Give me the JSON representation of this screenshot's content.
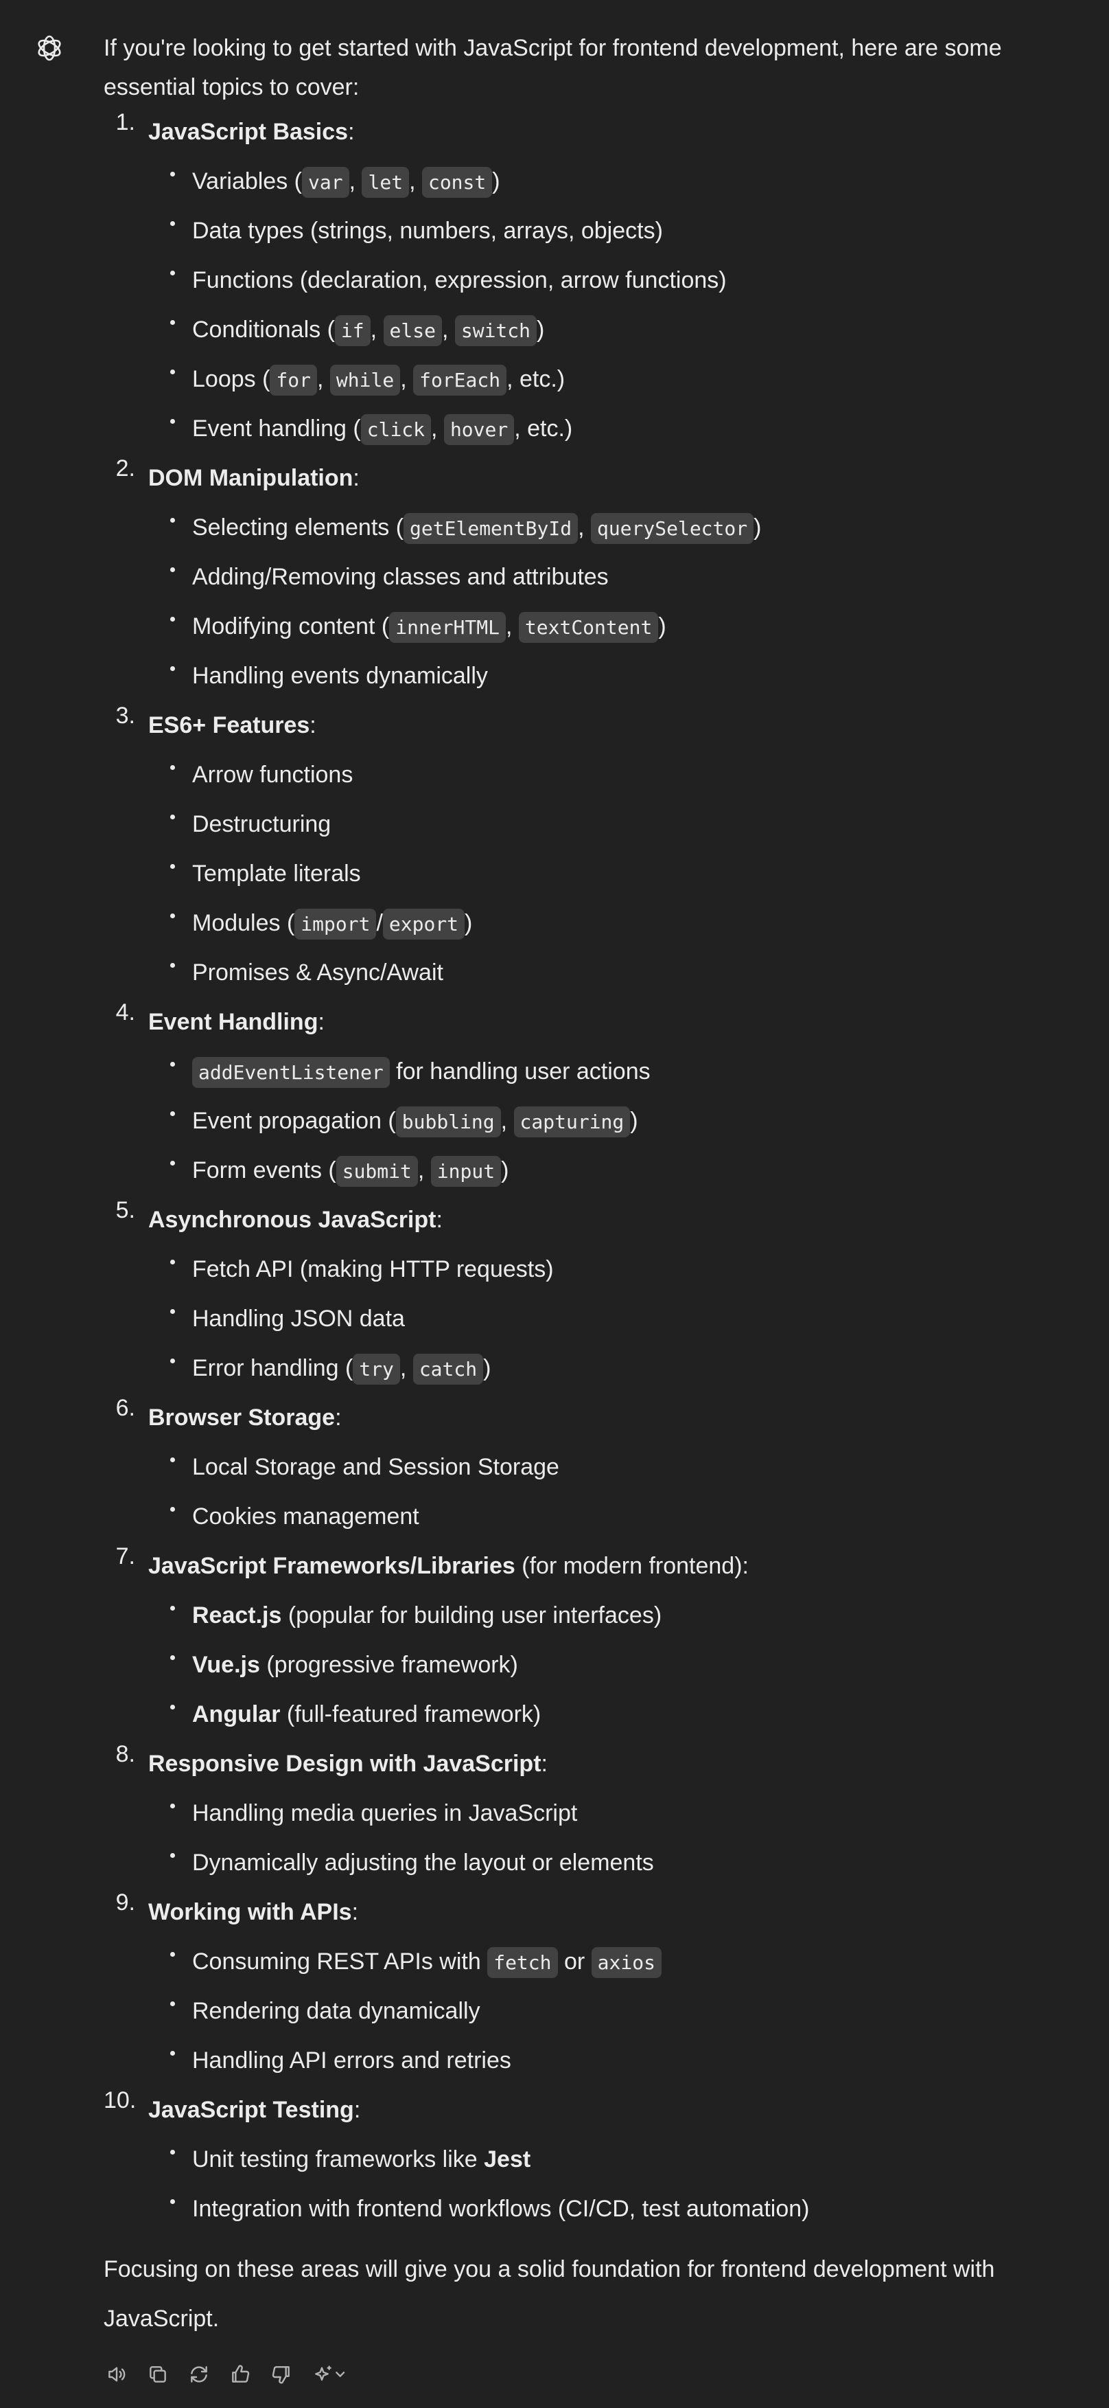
{
  "message": {
    "intro": "If you're looking to get started with JavaScript for frontend development, here are some essential topics to cover:",
    "topics": [
      {
        "num": "1.",
        "title": "JavaScript Basics",
        "title_suffix": "",
        "items": [
          [
            {
              "t": "Variables ("
            },
            {
              "c": "var"
            },
            {
              "t": ", "
            },
            {
              "c": "let"
            },
            {
              "t": ", "
            },
            {
              "c": "const"
            },
            {
              "t": ")"
            }
          ],
          [
            {
              "t": "Data types (strings, numbers, arrays, objects)"
            }
          ],
          [
            {
              "t": "Functions (declaration, expression, arrow functions)"
            }
          ],
          [
            {
              "t": "Conditionals ("
            },
            {
              "c": "if"
            },
            {
              "t": ", "
            },
            {
              "c": "else"
            },
            {
              "t": ", "
            },
            {
              "c": "switch"
            },
            {
              "t": ")"
            }
          ],
          [
            {
              "t": "Loops ("
            },
            {
              "c": "for"
            },
            {
              "t": ", "
            },
            {
              "c": "while"
            },
            {
              "t": ", "
            },
            {
              "c": "forEach"
            },
            {
              "t": ", etc.)"
            }
          ],
          [
            {
              "t": "Event handling ("
            },
            {
              "c": "click"
            },
            {
              "t": ", "
            },
            {
              "c": "hover"
            },
            {
              "t": ", etc.)"
            }
          ]
        ]
      },
      {
        "num": "2.",
        "title": "DOM Manipulation",
        "title_suffix": "",
        "items": [
          [
            {
              "t": "Selecting elements ("
            },
            {
              "c": "getElementById"
            },
            {
              "t": ", "
            },
            {
              "c": "querySelector"
            },
            {
              "t": ")"
            }
          ],
          [
            {
              "t": "Adding/Removing classes and attributes"
            }
          ],
          [
            {
              "t": "Modifying content ("
            },
            {
              "c": "innerHTML"
            },
            {
              "t": ", "
            },
            {
              "c": "textContent"
            },
            {
              "t": ")"
            }
          ],
          [
            {
              "t": "Handling events dynamically"
            }
          ]
        ]
      },
      {
        "num": "3.",
        "title": "ES6+ Features",
        "title_suffix": "",
        "items": [
          [
            {
              "t": "Arrow functions"
            }
          ],
          [
            {
              "t": "Destructuring"
            }
          ],
          [
            {
              "t": "Template literals"
            }
          ],
          [
            {
              "t": "Modules ("
            },
            {
              "c": "import"
            },
            {
              "t": "/"
            },
            {
              "c": "export"
            },
            {
              "t": ")"
            }
          ],
          [
            {
              "t": "Promises & Async/Await"
            }
          ]
        ]
      },
      {
        "num": "4.",
        "title": "Event Handling",
        "title_suffix": "",
        "items": [
          [
            {
              "c": "addEventListener"
            },
            {
              "t": " for handling user actions"
            }
          ],
          [
            {
              "t": "Event propagation ("
            },
            {
              "c": "bubbling"
            },
            {
              "t": ", "
            },
            {
              "c": "capturing"
            },
            {
              "t": ")"
            }
          ],
          [
            {
              "t": "Form events ("
            },
            {
              "c": "submit"
            },
            {
              "t": ", "
            },
            {
              "c": "input"
            },
            {
              "t": ")"
            }
          ]
        ]
      },
      {
        "num": "5.",
        "title": "Asynchronous JavaScript",
        "title_suffix": "",
        "items": [
          [
            {
              "t": "Fetch API (making HTTP requests)"
            }
          ],
          [
            {
              "t": "Handling JSON data"
            }
          ],
          [
            {
              "t": "Error handling ("
            },
            {
              "c": "try"
            },
            {
              "t": ", "
            },
            {
              "c": "catch"
            },
            {
              "t": ")"
            }
          ]
        ]
      },
      {
        "num": "6.",
        "title": "Browser Storage",
        "title_suffix": "",
        "items": [
          [
            {
              "t": "Local Storage and Session Storage"
            }
          ],
          [
            {
              "t": "Cookies management"
            }
          ]
        ]
      },
      {
        "num": "7.",
        "title": "JavaScript Frameworks/Libraries",
        "title_suffix": " (for modern frontend)",
        "items": [
          [
            {
              "b": "React.js"
            },
            {
              "t": " (popular for building user interfaces)"
            }
          ],
          [
            {
              "b": "Vue.js"
            },
            {
              "t": " (progressive framework)"
            }
          ],
          [
            {
              "b": "Angular"
            },
            {
              "t": " (full-featured framework)"
            }
          ]
        ]
      },
      {
        "num": "8.",
        "title": "Responsive Design with JavaScript",
        "title_suffix": "",
        "items": [
          [
            {
              "t": "Handling media queries in JavaScript"
            }
          ],
          [
            {
              "t": "Dynamically adjusting the layout or elements"
            }
          ]
        ]
      },
      {
        "num": "9.",
        "title": "Working with APIs",
        "title_suffix": "",
        "items": [
          [
            {
              "t": "Consuming REST APIs with "
            },
            {
              "c": "fetch"
            },
            {
              "t": " or "
            },
            {
              "c": "axios"
            }
          ],
          [
            {
              "t": "Rendering data dynamically"
            }
          ],
          [
            {
              "t": "Handling API errors and retries"
            }
          ]
        ]
      },
      {
        "num": "10.",
        "title": "JavaScript Testing",
        "title_suffix": "",
        "items": [
          [
            {
              "t": "Unit testing frameworks like "
            },
            {
              "b": "Jest"
            }
          ],
          [
            {
              "t": "Integration with frontend workflows (CI/CD, test automation)"
            }
          ]
        ]
      }
    ],
    "outro": "Focusing on these areas will give you a solid foundation for frontend development with JavaScript."
  },
  "actions": [
    {
      "name": "read-aloud-icon"
    },
    {
      "name": "copy-icon"
    },
    {
      "name": "regenerate-icon"
    },
    {
      "name": "thumbs-up-icon"
    },
    {
      "name": "thumbs-down-icon"
    },
    {
      "name": "sparkle-model-icon"
    }
  ],
  "colors": {
    "background": "#212121",
    "text": "#ececec",
    "code_bg": "#424242",
    "icon": "#b4b4b4"
  }
}
